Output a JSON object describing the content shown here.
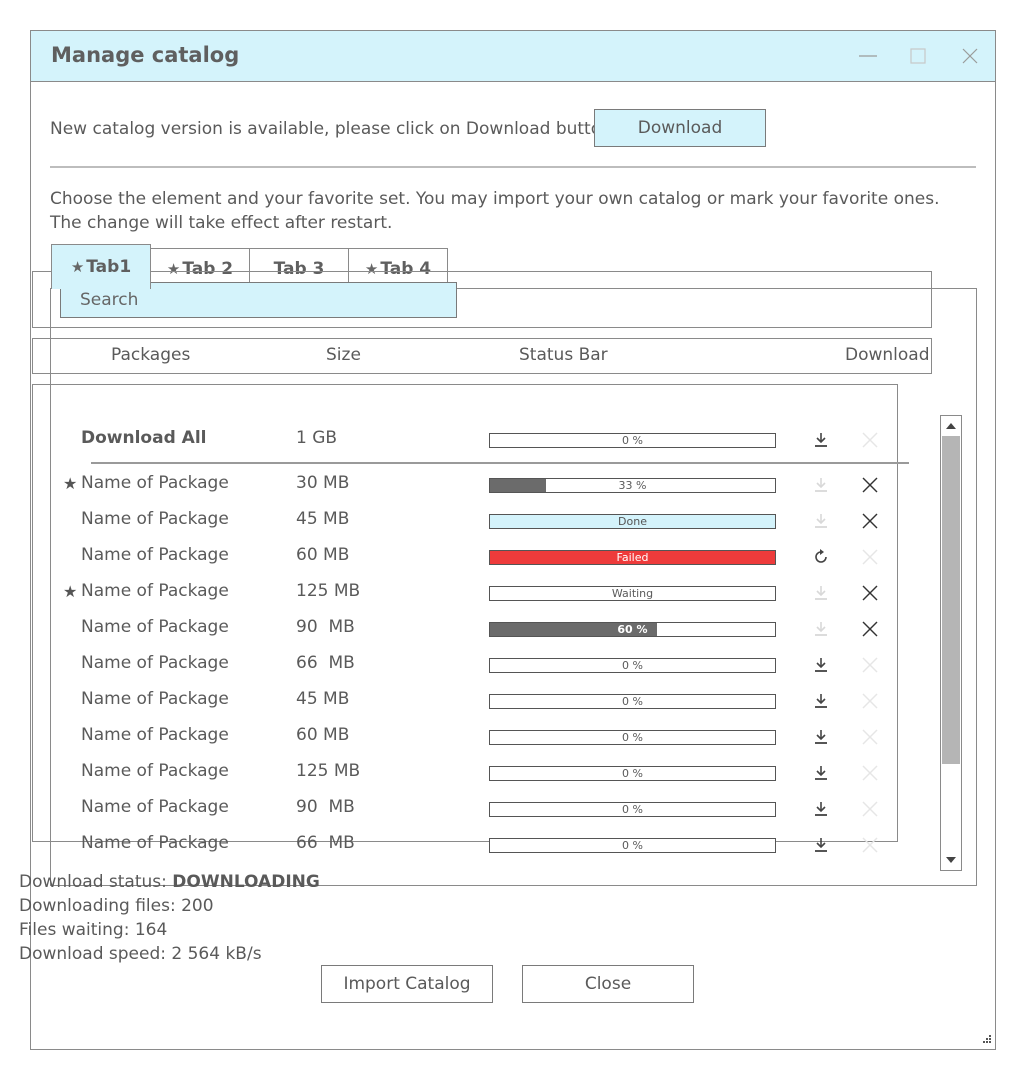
{
  "window": {
    "title": "Manage catalog"
  },
  "notice": {
    "text": "New catalog version is available, please click on Download button.",
    "button_label": "Download"
  },
  "description": {
    "line1": "Choose the element and your favorite set. You may import your own catalog or mark your favorite ones.",
    "line2": "The change will take effect after restart."
  },
  "tabs": [
    {
      "label": "Tab1",
      "favorite": true,
      "active": true
    },
    {
      "label": "Tab 2",
      "favorite": true,
      "active": false
    },
    {
      "label": "Tab 3",
      "favorite": false,
      "active": false
    },
    {
      "label": "Tab 4",
      "favorite": true,
      "active": false
    }
  ],
  "search": {
    "placeholder": "Search"
  },
  "table": {
    "headers": {
      "packages": "Packages",
      "size": "Size",
      "status": "Status Bar",
      "download": "Download"
    },
    "download_all": {
      "name": "Download All",
      "size": "1 GB",
      "status": "0 %",
      "progress": 0
    },
    "rows": [
      {
        "favorite": true,
        "name": "Name of Package",
        "size": "30 MB",
        "status": "33 %",
        "progress": 0.195,
        "state": "progress",
        "download_enabled": false,
        "cancel_enabled": true
      },
      {
        "favorite": false,
        "name": "Name of Package",
        "size": "45 MB",
        "status": "Done",
        "progress": 1,
        "state": "done",
        "download_enabled": false,
        "cancel_enabled": true
      },
      {
        "favorite": false,
        "name": "Name of Package",
        "size": "60 MB",
        "status": "Failed",
        "progress": 1,
        "state": "failed",
        "download_enabled": true,
        "cancel_enabled": false,
        "retry": true
      },
      {
        "favorite": true,
        "name": "Name of Package",
        "size": "125 MB",
        "status": "Waiting",
        "progress": 0,
        "state": "waiting",
        "download_enabled": false,
        "cancel_enabled": true
      },
      {
        "favorite": false,
        "name": "Name of Package",
        "size": "90  MB",
        "status": "60 %",
        "progress": 0.585,
        "state": "progress",
        "download_enabled": false,
        "cancel_enabled": true
      },
      {
        "favorite": false,
        "name": "Name of Package",
        "size": "66  MB",
        "status": "0 %",
        "progress": 0,
        "state": "idle",
        "download_enabled": true,
        "cancel_enabled": false
      },
      {
        "favorite": false,
        "name": "Name of Package",
        "size": "45 MB",
        "status": "0 %",
        "progress": 0,
        "state": "idle",
        "download_enabled": true,
        "cancel_enabled": false
      },
      {
        "favorite": false,
        "name": "Name of Package",
        "size": "60 MB",
        "status": "0 %",
        "progress": 0,
        "state": "idle",
        "download_enabled": true,
        "cancel_enabled": false
      },
      {
        "favorite": false,
        "name": "Name of Package",
        "size": "125 MB",
        "status": "0 %",
        "progress": 0,
        "state": "idle",
        "download_enabled": true,
        "cancel_enabled": false
      },
      {
        "favorite": false,
        "name": "Name of Package",
        "size": "90  MB",
        "status": "0 %",
        "progress": 0,
        "state": "idle",
        "download_enabled": true,
        "cancel_enabled": false
      },
      {
        "favorite": false,
        "name": "Name of Package",
        "size": "66  MB",
        "status": "0 %",
        "progress": 0,
        "state": "idle",
        "download_enabled": true,
        "cancel_enabled": false
      }
    ]
  },
  "status": {
    "download_status_label": "Download status: ",
    "download_status_value": "DOWNLOADING",
    "downloading_files": "Downloading files: 200",
    "files_waiting": "Files waiting: 164",
    "download_speed": "Download speed: 2 564 kB/s"
  },
  "buttons": {
    "import": "Import Catalog",
    "close": "Close"
  },
  "colors": {
    "accent": "#d4f3fb",
    "progress": "#6b6b6b",
    "failed": "#ee3b3b",
    "done": "#d4f3fb",
    "text": "#5a5a5a"
  },
  "icons": {
    "download": "download-icon",
    "cancel": "close-icon",
    "retry": "refresh-icon",
    "favorite": "star-icon"
  }
}
